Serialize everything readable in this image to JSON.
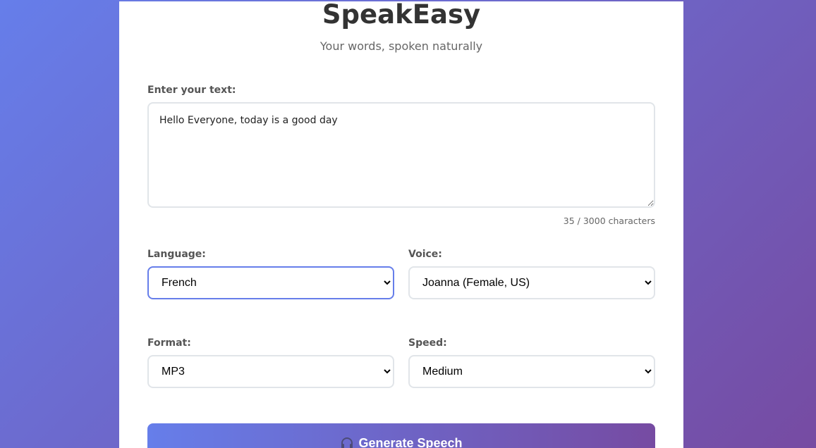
{
  "app": {
    "title": "SpeakEasy",
    "subtitle": "Your words, spoken naturally"
  },
  "text_input": {
    "label": "Enter your text:",
    "value": "Hello Everyone, today is a good day",
    "char_count": "35 / 3000 characters"
  },
  "language": {
    "label": "Language:",
    "selected": "French"
  },
  "voice": {
    "label": "Voice:",
    "selected": "Joanna (Female, US)"
  },
  "format": {
    "label": "Format:",
    "selected": "MP3"
  },
  "speed": {
    "label": "Speed:",
    "selected": "Medium"
  },
  "generate_button": {
    "label": "Generate Speech",
    "icon": "headphones-icon"
  },
  "colors": {
    "gradient_start": "#667eea",
    "gradient_end": "#764ba2",
    "focus_border": "#667eea"
  }
}
